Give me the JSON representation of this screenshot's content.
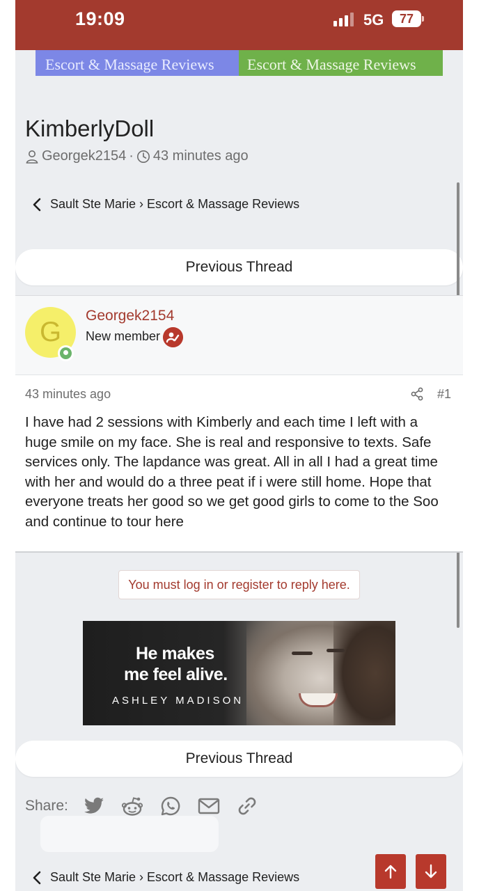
{
  "status_bar": {
    "time": "19:09",
    "network": "5G",
    "battery": "77"
  },
  "banner": {
    "left_text": "Escort & Massage Reviews",
    "right_text": "Escort & Massage Reviews",
    "left_color": "#7c87e6",
    "right_color": "#6fb14a"
  },
  "thread": {
    "title": "KimberlyDoll",
    "author": "Georgek2154",
    "separator": "·",
    "time": "43 minutes ago"
  },
  "breadcrumb": {
    "text": "Sault Ste Marie › Escort & Massage Reviews"
  },
  "nav": {
    "previous_thread": "Previous Thread"
  },
  "post": {
    "avatar_letter": "G",
    "username": "Georgek2154",
    "member_title": "New member",
    "time": "43 minutes ago",
    "number": "#1",
    "body": "I have had 2 sessions with Kimberly and each time I left with a huge smile on my face. She is real and responsive to texts. Safe services only. The lapdance was great. All in all I had a great time with her and would do a three peat if i were still home. Hope that everyone treats her good so we get good girls to come to the Soo and continue to tour here"
  },
  "login_notice": "You must log in or register to reply here.",
  "ad": {
    "line1": "He makes",
    "line2": "me feel alive.",
    "brand": "ASHLEY MADISON"
  },
  "share": {
    "label": "Share:",
    "icons": [
      "twitter-icon",
      "reddit-icon",
      "whatsapp-icon",
      "email-icon",
      "link-icon"
    ]
  },
  "colors": {
    "accent": "#a33a2e",
    "button": "#b8392c",
    "background": "#eceef1"
  }
}
